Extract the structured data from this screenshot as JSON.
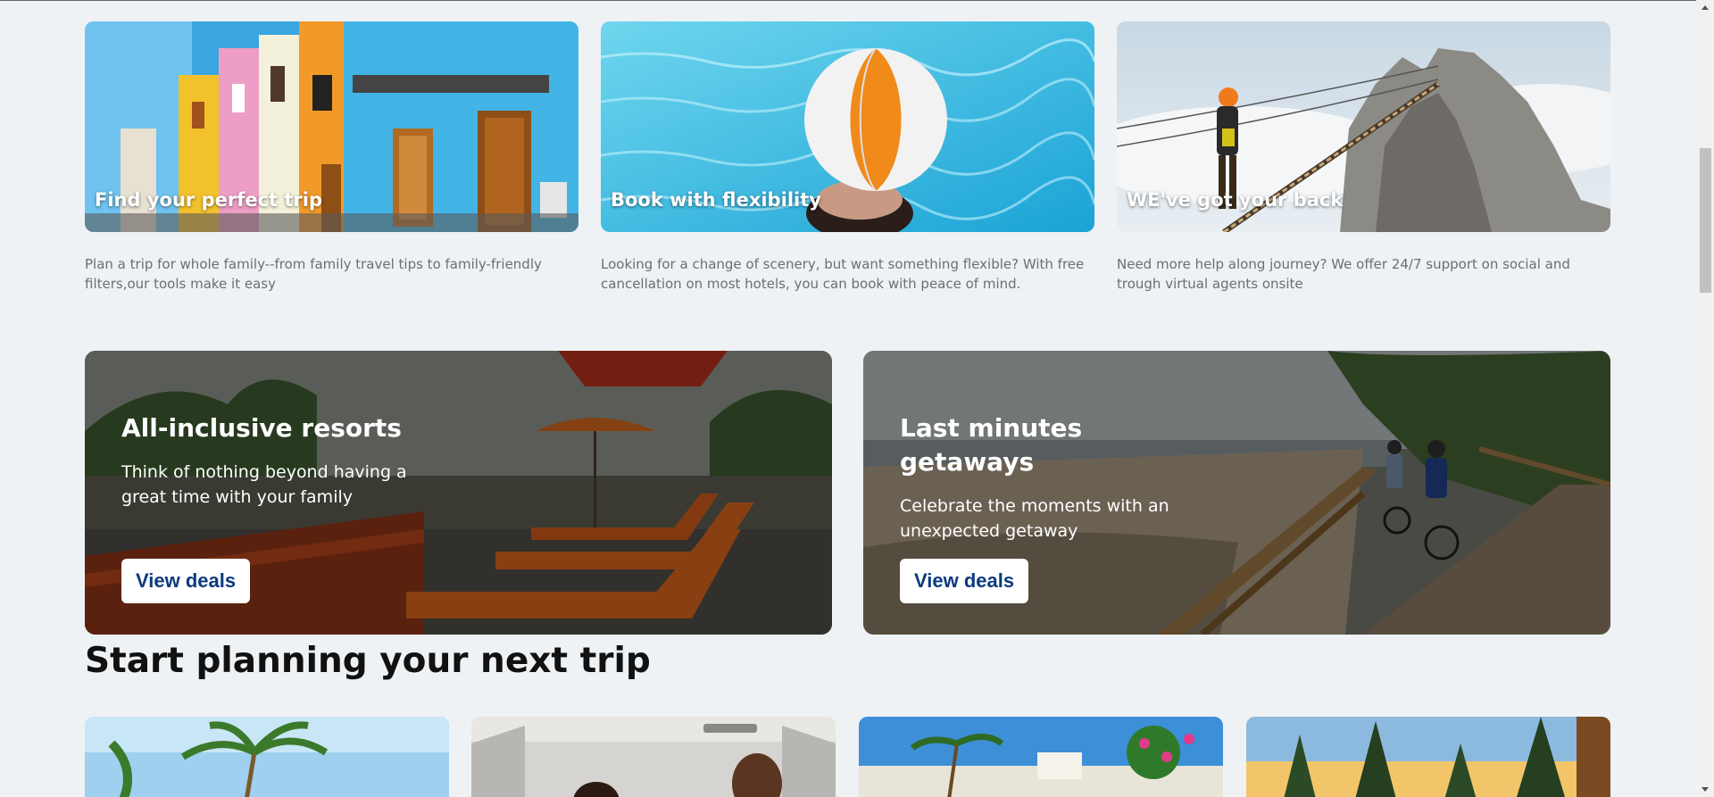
{
  "features": [
    {
      "title": "Find your perfect trip",
      "description": "Plan a trip for whole family--from family travel tips to family-friendly filters,our tools make it easy"
    },
    {
      "title": "Book with flexibility",
      "description": "Looking for a change of scenery, but want something flexible? With free cancellation on most hotels, you can book with peace of mind."
    },
    {
      "title": "WE've got your back",
      "description": "Need more help along journey? We offer 24/7 support on social and trough virtual agents onsite"
    }
  ],
  "promos": [
    {
      "title": "All-inclusive resorts",
      "subtitle": "Think of nothing beyond having a great time with your family",
      "button_label": "View deals"
    },
    {
      "title": "Last minutes getaways",
      "subtitle": "Celebrate the moments with an unexpected getaway",
      "button_label": "View deals"
    }
  ],
  "planning": {
    "title": "Start planning your next trip"
  },
  "colors": {
    "background": "#eef2f5",
    "button_text": "#0b3a7e",
    "description_text": "#6e6e6e"
  }
}
